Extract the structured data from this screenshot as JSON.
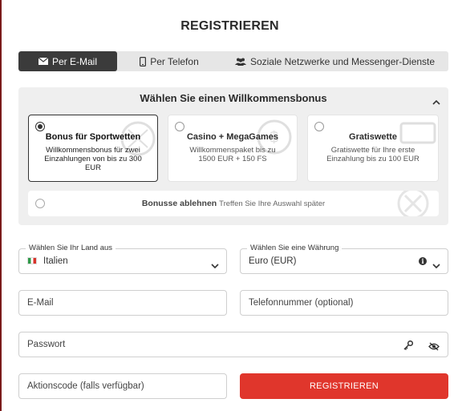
{
  "page": {
    "title": "REGISTRIEREN"
  },
  "tabs": [
    {
      "label": "Per E-Mail",
      "icon": "envelope-icon",
      "active": true
    },
    {
      "label": "Per Telefon",
      "icon": "phone-icon",
      "active": false
    },
    {
      "label": "Soziale Netzwerke und Messenger-Dienste",
      "icon": "users-icon",
      "active": false
    }
  ],
  "bonus": {
    "heading": "Wählen Sie einen Willkommensbonus",
    "options": [
      {
        "title": "Bonus für Sportwetten",
        "description": "Willkommensbonus für zwei Einzahlungen von bis zu 300 EUR",
        "selected": true
      },
      {
        "title": "Casino + MegaGames",
        "description": "Willkommenspaket bis zu 1500 EUR + 150 FS",
        "selected": false
      },
      {
        "title": "Gratiswette",
        "description": "Gratiswette für Ihre erste Einzahlung bis zu 100 EUR",
        "selected": false
      }
    ],
    "decline": {
      "title": "Bonusse ablehnen",
      "subtitle": "Treffen Sie Ihre Auswahl später"
    }
  },
  "form": {
    "country": {
      "label": "Wählen Sie Ihr Land aus",
      "value": "Italien"
    },
    "currency": {
      "label": "Wählen Sie eine Währung",
      "value": "Euro (EUR)"
    },
    "email": {
      "placeholder": "E-Mail"
    },
    "phone": {
      "placeholder": "Telefonnummer (optional)"
    },
    "password": {
      "placeholder": "Passwort"
    },
    "promo": {
      "placeholder": "Aktionscode (falls verfügbar)"
    },
    "submit_label": "REGISTRIEREN"
  },
  "colors": {
    "accent": "#e0362c",
    "active_tab": "#3b3b3b"
  }
}
